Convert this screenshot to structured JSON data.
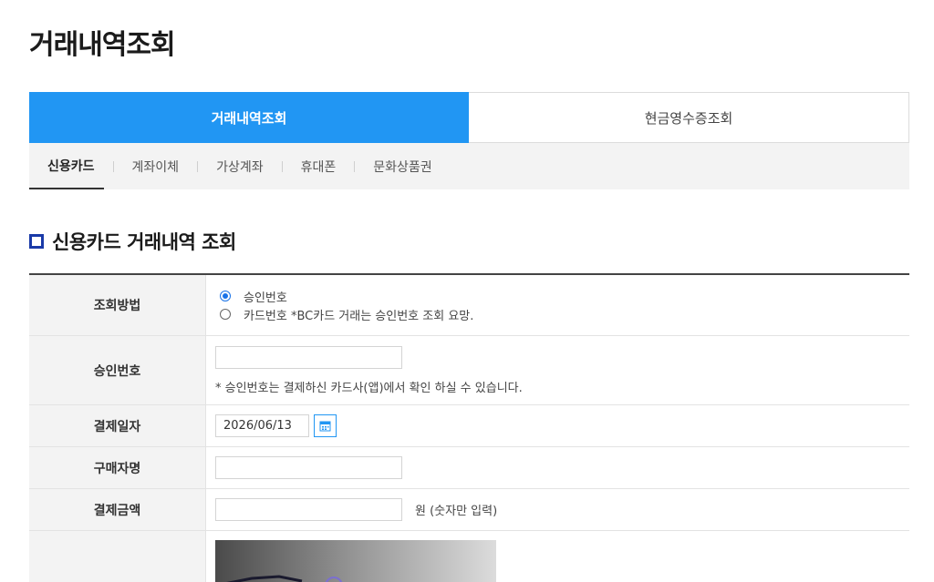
{
  "page": {
    "title": "거래내역조회"
  },
  "main_tabs": [
    {
      "label": "거래내역조회",
      "active": true
    },
    {
      "label": "현금영수증조회",
      "active": false
    }
  ],
  "sub_tabs": [
    {
      "label": "신용카드",
      "active": true
    },
    {
      "label": "계좌이체",
      "active": false
    },
    {
      "label": "가상계좌",
      "active": false
    },
    {
      "label": "휴대폰",
      "active": false
    },
    {
      "label": "문화상품권",
      "active": false
    }
  ],
  "section": {
    "title": "신용카드 거래내역 조회"
  },
  "form": {
    "method": {
      "label": "조회방법",
      "options": [
        {
          "label": "승인번호",
          "checked": true
        },
        {
          "label": "카드번호 *BC카드 거래는 승인번호 조회 요망.",
          "checked": false
        }
      ]
    },
    "approval": {
      "label": "승인번호",
      "value": "",
      "hint": "* 승인번호는 결제하신 카드사(앱)에서 확인 하실 수 있습니다."
    },
    "date": {
      "label": "결제일자",
      "value": "2026/06/13"
    },
    "buyer": {
      "label": "구매자명",
      "value": ""
    },
    "amount": {
      "label": "결제금액",
      "value": "",
      "unit": "원 (숫자만 입력)"
    }
  },
  "colors": {
    "accent": "#2196f3",
    "section_icon": "#1a3aa8"
  },
  "icons": {
    "calendar": "calendar-icon",
    "section": "square-icon"
  }
}
